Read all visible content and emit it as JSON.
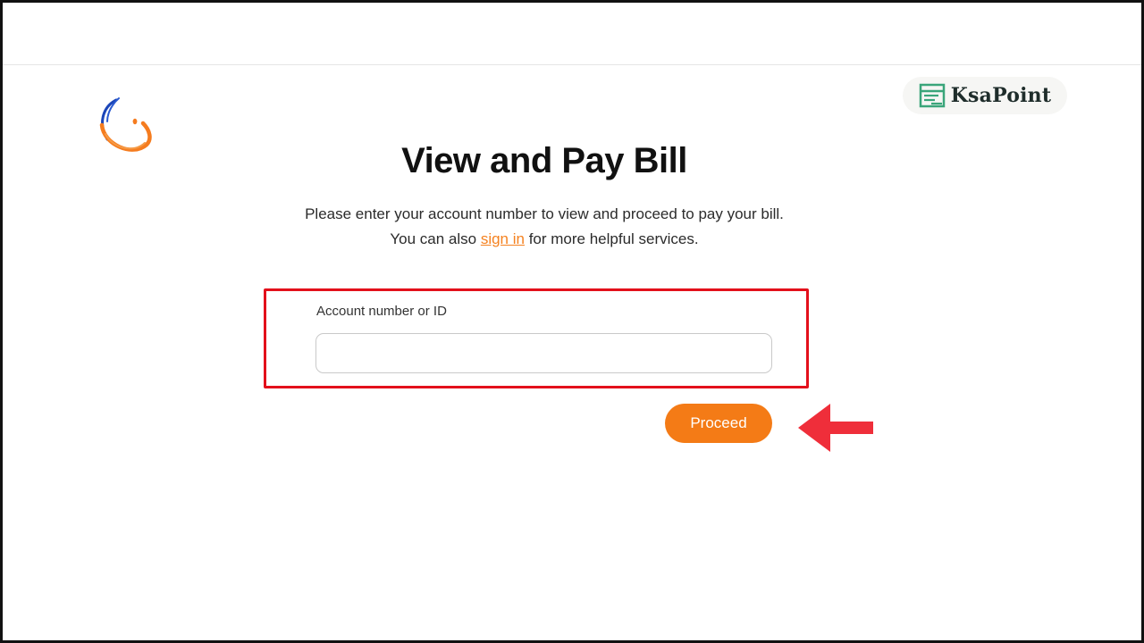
{
  "watermark": {
    "text": "KsaPoint",
    "icon": "list-document-icon"
  },
  "page": {
    "title": "View and Pay Bill",
    "intro_before": "Please enter your account number to view and proceed to pay your bill. You can also ",
    "signin_link": "sign in",
    "intro_after": " for more helpful services."
  },
  "form": {
    "account_label": "Account number or ID",
    "account_value": "",
    "account_placeholder": "",
    "proceed_label": "Proceed"
  },
  "colors": {
    "accent_orange": "#f47b16",
    "link_orange": "#f58220",
    "highlight_red": "#e3101b",
    "arrow_red": "#ef2e3a",
    "watermark_green": "#3aa57a",
    "logo_blue": "#1b45b8"
  },
  "annotations": {
    "highlight": "red-outline-box",
    "arrow": "left-pointing-red-arrow"
  }
}
